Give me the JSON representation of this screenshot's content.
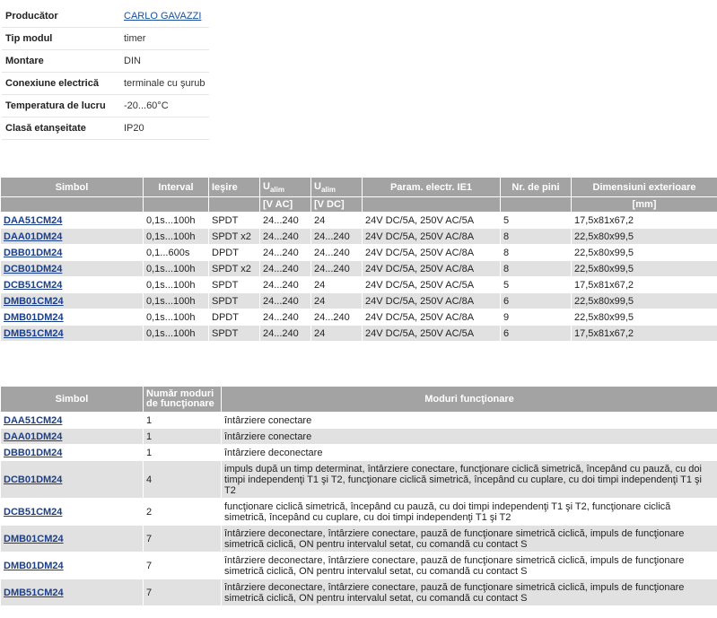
{
  "specs": [
    {
      "label": "Producător",
      "value": "CARLO GAVAZZI",
      "link": true
    },
    {
      "label": "Tip modul",
      "value": "timer"
    },
    {
      "label": "Montare",
      "value": "DIN"
    },
    {
      "label": "Conexiune electrică",
      "value": "terminale cu şurub"
    },
    {
      "label": "Temperatura de lucru",
      "value": "-20...60°C"
    },
    {
      "label": "Clasă etanşeitate",
      "value": "IP20"
    }
  ],
  "table1": {
    "headers": {
      "simbol": "Simbol",
      "interval": "Interval",
      "iesire": "Ieşire",
      "u_base": "U",
      "u_sub": "alim",
      "u_ac_unit": "[V AC]",
      "u_dc_unit": "[V DC]",
      "param": "Param. electr. IE1",
      "pini": "Nr. de pini",
      "dim": "Dimensiuni exterioare",
      "dim_unit": "[mm]"
    },
    "rows": [
      {
        "simbol": "DAA51CM24",
        "interval": "0,1s...100h",
        "iesire": "SPDT",
        "uac": "24...240",
        "udc": "24",
        "param": "24V DC/5A, 250V AC/5A",
        "pini": "5",
        "dim": "17,5x81x67,2"
      },
      {
        "simbol": "DAA01DM24",
        "interval": "0,1s...100h",
        "iesire": "SPDT x2",
        "uac": "24...240",
        "udc": "24...240",
        "param": "24V DC/5A, 250V AC/8A",
        "pini": "8",
        "dim": "22,5x80x99,5"
      },
      {
        "simbol": "DBB01DM24",
        "interval": "0,1...600s",
        "iesire": "DPDT",
        "uac": "24...240",
        "udc": "24...240",
        "param": "24V DC/5A, 250V AC/8A",
        "pini": "8",
        "dim": "22,5x80x99,5"
      },
      {
        "simbol": "DCB01DM24",
        "interval": "0,1s...100h",
        "iesire": "SPDT x2",
        "uac": "24...240",
        "udc": "24...240",
        "param": "24V DC/5A, 250V AC/8A",
        "pini": "8",
        "dim": "22,5x80x99,5"
      },
      {
        "simbol": "DCB51CM24",
        "interval": "0,1s...100h",
        "iesire": "SPDT",
        "uac": "24...240",
        "udc": "24",
        "param": "24V DC/5A, 250V AC/5A",
        "pini": "5",
        "dim": "17,5x81x67,2"
      },
      {
        "simbol": "DMB01CM24",
        "interval": "0,1s...100h",
        "iesire": "SPDT",
        "uac": "24...240",
        "udc": "24",
        "param": "24V DC/5A, 250V AC/8A",
        "pini": "6",
        "dim": "22,5x80x99,5"
      },
      {
        "simbol": "DMB01DM24",
        "interval": "0,1s...100h",
        "iesire": "DPDT",
        "uac": "24...240",
        "udc": "24...240",
        "param": "24V DC/5A, 250V AC/8A",
        "pini": "9",
        "dim": "22,5x80x99,5"
      },
      {
        "simbol": "DMB51CM24",
        "interval": "0,1s...100h",
        "iesire": "SPDT",
        "uac": "24...240",
        "udc": "24",
        "param": "24V DC/5A, 250V AC/5A",
        "pini": "6",
        "dim": "17,5x81x67,2"
      }
    ]
  },
  "table2": {
    "headers": {
      "simbol": "Simbol",
      "nr_moduri": "Număr moduri de funcţionare",
      "moduri": "Moduri funcţionare"
    },
    "rows": [
      {
        "simbol": "DAA51CM24",
        "nr": "1",
        "moduri": "întârziere conectare"
      },
      {
        "simbol": "DAA01DM24",
        "nr": "1",
        "moduri": "întârziere conectare"
      },
      {
        "simbol": "DBB01DM24",
        "nr": "1",
        "moduri": "întârziere deconectare"
      },
      {
        "simbol": "DCB01DM24",
        "nr": "4",
        "moduri": "impuls după un timp determinat, întârziere conectare, funcţionare ciclică simetrică, începând cu pauză, cu doi timpi independenţi T1 şi T2, funcţionare ciclică simetrică, începând cu cuplare, cu doi timpi independenţi T1 şi T2"
      },
      {
        "simbol": "DCB51CM24",
        "nr": "2",
        "moduri": "funcţionare ciclică simetrică, începând cu pauză, cu doi timpi independenţi T1 şi T2, funcţionare ciclică simetrică, începând cu cuplare, cu doi timpi independenţi T1 şi T2"
      },
      {
        "simbol": "DMB01CM24",
        "nr": "7",
        "moduri": "întârziere deconectare, întârziere conectare, pauză de funcţionare simetrică ciclică, impuls de funcţionare simetrică ciclică, ON pentru intervalul setat, cu comandă cu contact S"
      },
      {
        "simbol": "DMB01DM24",
        "nr": "7",
        "moduri": "întârziere deconectare, întârziere conectare, pauză de funcţionare simetrică ciclică, impuls de funcţionare simetrică ciclică, ON pentru intervalul setat, cu comandă cu contact S"
      },
      {
        "simbol": "DMB51CM24",
        "nr": "7",
        "moduri": "întârziere deconectare, întârziere conectare, pauză de funcţionare simetrică ciclică, impuls de funcţionare simetrică ciclică, ON pentru intervalul setat, cu comandă cu contact S"
      }
    ]
  }
}
